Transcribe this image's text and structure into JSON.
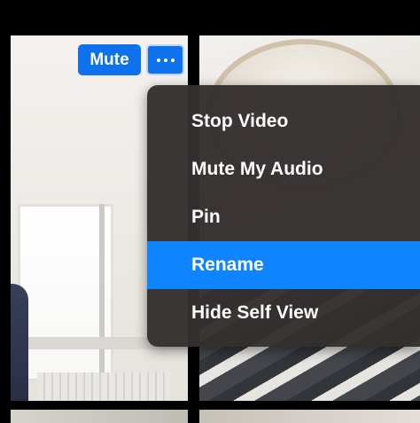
{
  "participant_tile": {
    "mute_label": "Mute",
    "more_icon": "ellipsis-horizontal-icon"
  },
  "context_menu": {
    "items": [
      {
        "label": "Stop Video",
        "selected": false
      },
      {
        "label": "Mute My Audio",
        "selected": false
      },
      {
        "label": "Pin",
        "selected": false
      },
      {
        "label": "Rename",
        "selected": true
      },
      {
        "label": "Hide Self View",
        "selected": false
      }
    ]
  },
  "colors": {
    "accent_blue": "#0e72ed",
    "menu_highlight": "#0e84ff",
    "menu_background": "#34302e",
    "menu_text": "#ffffff"
  }
}
